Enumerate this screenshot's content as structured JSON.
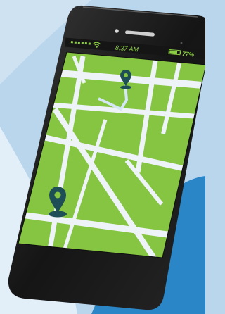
{
  "status_bar": {
    "signal_bars": 6,
    "time": "8:37 AM",
    "battery_percent": "77%",
    "battery_level": 0.77
  },
  "map": {
    "pins": [
      {
        "name": "destination-pin"
      },
      {
        "name": "origin-pin"
      }
    ]
  },
  "colors": {
    "background": "#b9d6ec",
    "background_light": "#e2eef8",
    "accent_blue": "#2a86c6",
    "phone_body": "#1c1c1c",
    "screen_map": "#86c541",
    "road": "#eef3f7",
    "route": "#d5e6f5",
    "pin": "#1f4f56",
    "status_text": "#8ccf44"
  },
  "icons": {
    "wifi": "wifi-icon",
    "battery": "battery-icon",
    "pin": "map-pin-icon"
  }
}
